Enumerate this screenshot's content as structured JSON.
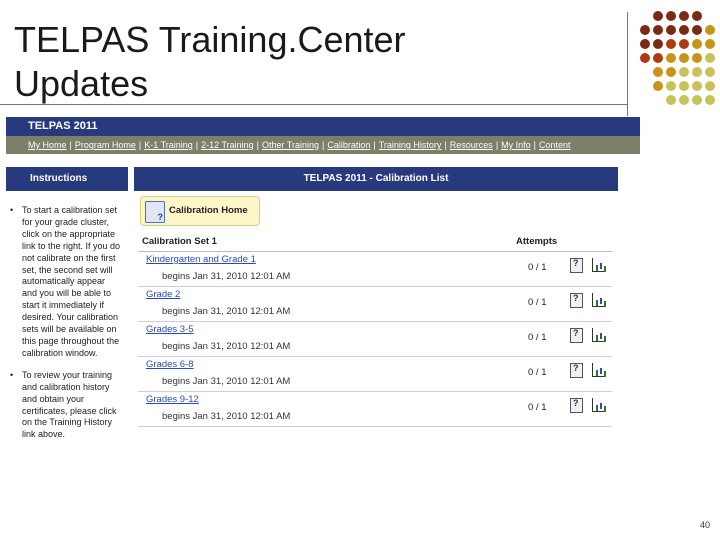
{
  "slide": {
    "title_line1": "TELPAS Training.Center",
    "title_line2": "Updates",
    "page_number": "40",
    "dot_colors": {
      "brown": "#7a2a12",
      "rust": "#b03a10",
      "gold": "#c99318",
      "olive": "#c8c25a"
    }
  },
  "app": {
    "header_title": "TELPAS 2011",
    "nav_links": [
      "My Home",
      "Program Home",
      "K-1 Training",
      "2-12 Training",
      "Other Training",
      "Calibration",
      "Training History",
      "Resources",
      "My Info",
      "Content"
    ],
    "instructions": {
      "title": "Instructions",
      "items": [
        "To start a calibration set for your grade cluster, click on the appropriate link to the right. If you do not calibrate on the first set, the second set will automatically appear and you will be able to start it immediately if desired. Your calibration sets will be available on this page throughout the calibration window.",
        "To review your training and calibration history and obtain your certificates, please click on the Training History link above."
      ]
    },
    "calibration": {
      "title": "TELPAS 2011 - Calibration List",
      "home_button": "Calibration Home",
      "set_title": "Calibration Set 1",
      "attempts_header": "Attempts",
      "rows": [
        {
          "grade": "Kindergarten and Grade 1",
          "begins": "begins Jan 31, 2010 12:01 AM",
          "attempts": "0 / 1"
        },
        {
          "grade": "Grade 2",
          "begins": "begins Jan 31, 2010 12:01 AM",
          "attempts": "0 / 1"
        },
        {
          "grade": "Grades 3-5",
          "begins": "begins Jan 31, 2010 12:01 AM",
          "attempts": "0 / 1"
        },
        {
          "grade": "Grades 6-8",
          "begins": "begins Jan 31, 2010 12:01 AM",
          "attempts": "0 / 1"
        },
        {
          "grade": "Grades 9-12",
          "begins": "begins Jan 31, 2010 12:01 AM",
          "attempts": "0 / 1"
        }
      ]
    }
  }
}
